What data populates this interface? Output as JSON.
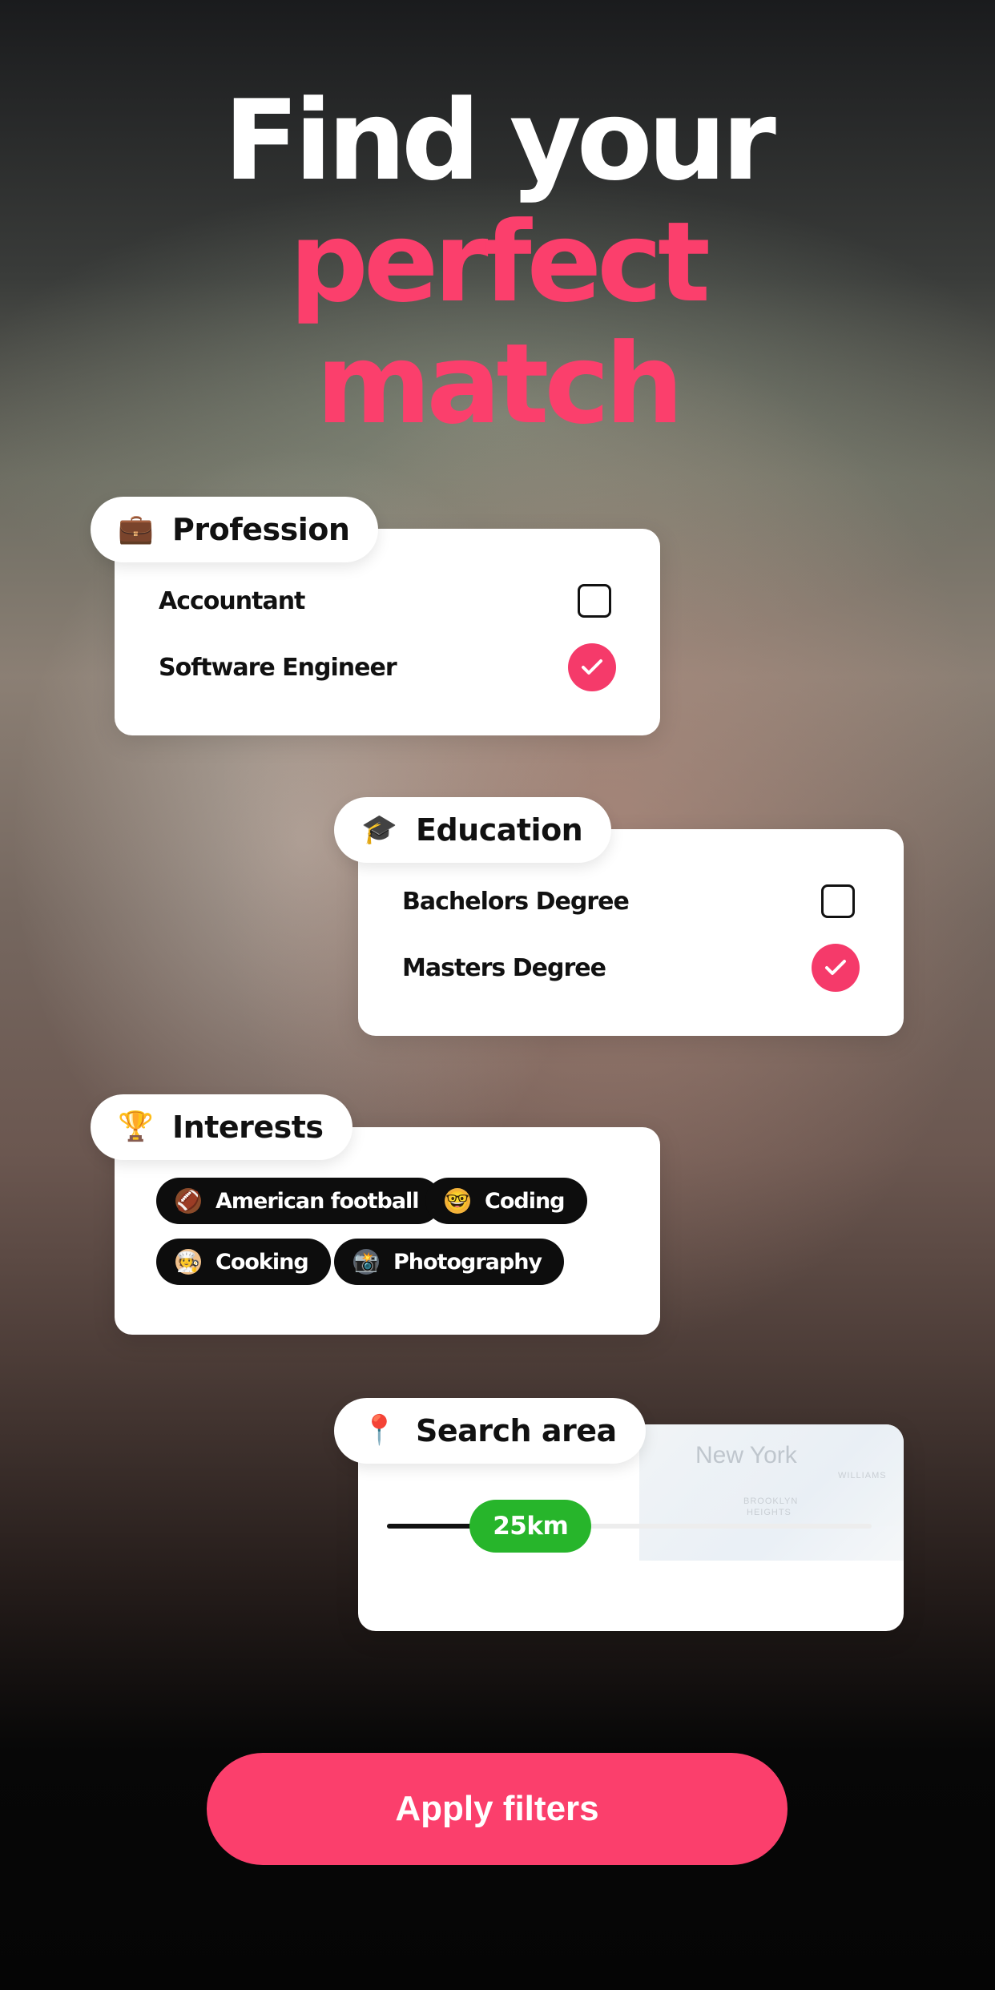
{
  "hero": {
    "line1": "Find your",
    "line2": "perfect",
    "line3": "match"
  },
  "profession": {
    "title": "Profession",
    "icon": "briefcase-icon",
    "options": [
      {
        "label": "Accountant",
        "checked": false
      },
      {
        "label": "Software Engineer",
        "checked": true
      }
    ]
  },
  "education": {
    "title": "Education",
    "icon": "graduation-cap-icon",
    "options": [
      {
        "label": "Bachelors Degree",
        "checked": false
      },
      {
        "label": "Masters Degree",
        "checked": true
      }
    ]
  },
  "interests": {
    "title": "Interests",
    "icon": "trophy-icon",
    "chips": [
      {
        "label": "American football",
        "icon": "football-icon"
      },
      {
        "label": "Coding",
        "icon": "nerd-face-icon"
      },
      {
        "label": "Cooking",
        "icon": "cook-icon"
      },
      {
        "label": "Photography",
        "icon": "camera-flash-icon"
      }
    ]
  },
  "search_area": {
    "title": "Search area",
    "icon": "pin-icon",
    "value_label": "25km",
    "level": 0.25,
    "map_city": "New York",
    "map_labels": [
      "WILLIAMS",
      "BROOKLYN",
      "HEIGHTS"
    ]
  },
  "apply": {
    "label": "Apply filters"
  },
  "colors": {
    "accent": "#fb3f6c",
    "check": "#f53a6a",
    "slider_thumb": "#27b52b",
    "chip_bg": "#0d0d0d"
  }
}
